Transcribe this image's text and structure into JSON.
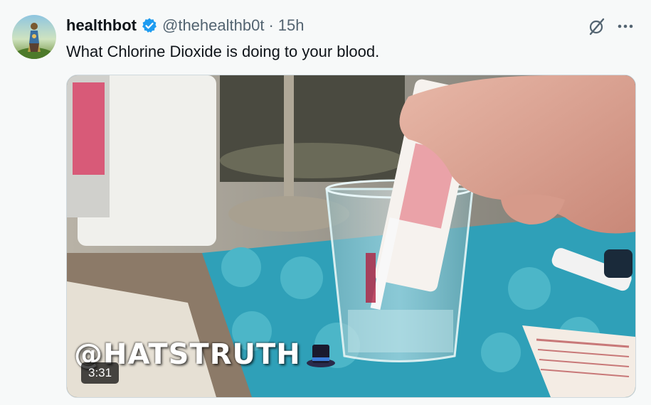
{
  "tweet": {
    "display_name": "healthbot",
    "handle": "@thehealthb0t",
    "separator": "·",
    "time": "15h",
    "text": "What Chlorine Dioxide is doing to your blood.",
    "verified_icon": "verified-badge-icon",
    "grok_icon": "grok-icon",
    "more_icon": "more-icon"
  },
  "media": {
    "watermark": "@HATSTRUTH",
    "watermark_icon": "top-hat-icon",
    "duration": "3:31"
  },
  "colors": {
    "verified": "#1d9bf0",
    "secondary_text": "#536471",
    "border": "#cfd9de",
    "background": "#f7f9f9"
  }
}
